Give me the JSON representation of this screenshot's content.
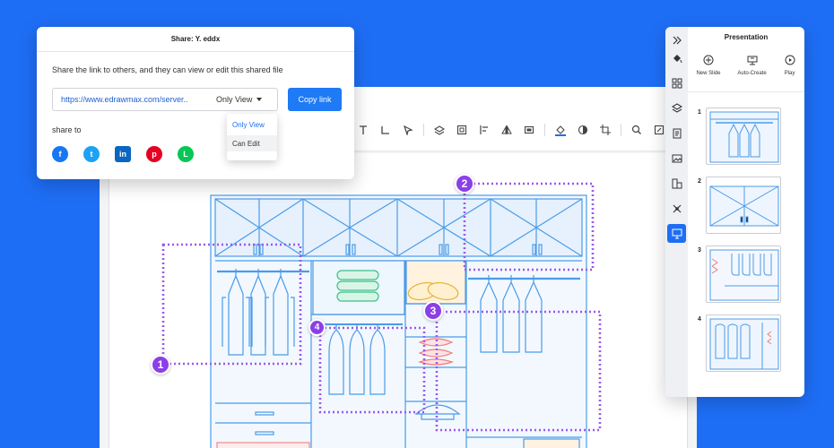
{
  "share_dialog": {
    "title": "Share: Y. eddx",
    "description": "Share the link to others, and they can view or edit this shared file",
    "link_url": "https://www.edrawmax.com/server..",
    "permission_value": "Only View",
    "copy_label": "Copy link",
    "share_to_label": "share to",
    "permission_options": [
      "Only View",
      "Can Edit"
    ],
    "socials": [
      {
        "name": "facebook",
        "glyph": "f",
        "color": "#1877f2"
      },
      {
        "name": "twitter",
        "glyph": "t",
        "color": "#1da1f2"
      },
      {
        "name": "linkedin",
        "glyph": "in",
        "color": "#0a66c2"
      },
      {
        "name": "pinterest",
        "glyph": "p",
        "color": "#e60023"
      },
      {
        "name": "line",
        "glyph": "L",
        "color": "#06c755"
      }
    ]
  },
  "presentation_panel": {
    "title": "Presentation",
    "actions": [
      {
        "label": "New Slide",
        "icon": "plus-circle-icon"
      },
      {
        "label": "Auto-Create",
        "icon": "auto-create-icon"
      },
      {
        "label": "Play",
        "icon": "play-icon"
      }
    ],
    "slides": [
      "1",
      "2",
      "3",
      "4"
    ]
  },
  "canvas_markers": [
    "1",
    "2",
    "3",
    "4"
  ],
  "toolbar_icons": [
    "text-icon",
    "connector-icon",
    "pointer-icon",
    "layers-icon",
    "group-icon",
    "align-icon",
    "flip-icon",
    "frame-icon",
    "fill-icon",
    "shadow-icon",
    "crop-icon",
    "search-icon",
    "edit-icon",
    "pen-icon"
  ],
  "colors": {
    "background": "#1e6ef5",
    "accent": "#1e6ef5",
    "marker": "#8b3fe8",
    "drawing_line": "#4a9be8",
    "selection_dots": "#9b59e8"
  }
}
